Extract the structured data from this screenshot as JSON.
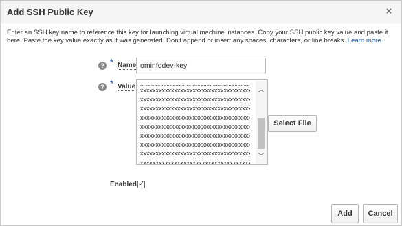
{
  "dialog": {
    "title": "Add SSH Public Key",
    "close_glyph": "×",
    "close_icon": "close-icon"
  },
  "intro": {
    "text": "Enter an SSH key name to reference this key for launching virtual machine instances. Copy your SSH public key value and paste it here. Paste the key value exactly as it was generated. Don't append or insert any spaces, characters, or line breaks.",
    "link": "Learn more."
  },
  "form": {
    "help_glyph": "?",
    "required_marker": "*",
    "name": {
      "label": "Name",
      "value": "ominfodev-key"
    },
    "value": {
      "label": "Value",
      "lines": [
        "xxxxxxxxxxxxxxxxxxxxxxxxxxxxxxxxxxxx",
        "xxxxxxxxxxxxxxxxxxxxxxxxxxxxxxxxxxxx",
        "xxxxxxxxxxxxxxxxxxxxxxxxxxxxxxxxxxxx",
        "xxxxxxxxxxxxxxxxxxxxxxxxxxxxxxxxxxxx",
        "xxxxxxxxxxxxxxxxxxxxxxxxxxxxxxxxxxxx",
        "xxxxxxxxxxxxxxxxxxxxxxxxxxxxxxxxxxxx",
        "xxxxxxxxxxxxxxxxxxxxxxxxxxxxxxxxxxxx",
        "xxxxxxxxxxxxxxxxxxxxxxxxxxxxxxxxxxxx",
        "xxxxxxxxxxxxxxxxxxxxxxxxxxxxxxxxxxxx"
      ],
      "scroll_up_glyph": "︿",
      "scroll_down_glyph": "﹀"
    },
    "select_file_label": "Select File",
    "enabled": {
      "label": "Enabled",
      "checked": true,
      "check_glyph": "✓"
    }
  },
  "footer": {
    "add_label": "Add",
    "cancel_label": "Cancel"
  },
  "colors": {
    "link": "#1f5fa8",
    "required": "#3b6fb6",
    "header_bg": "#f5f5f5"
  }
}
